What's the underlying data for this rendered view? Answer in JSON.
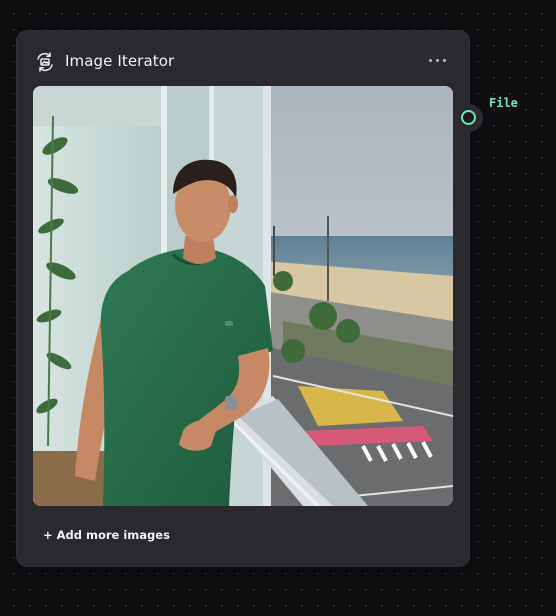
{
  "node": {
    "title": "Image Iterator",
    "icon": "image-loop-icon",
    "menu_icon": "more-horizontal-icon",
    "add_more_label": "+ Add more images",
    "image": {
      "description_icon": "photo-thumbnail"
    }
  },
  "output": {
    "label": "File",
    "color": "#6ee7b7"
  },
  "colors": {
    "canvas": "#0f0f12",
    "node_bg": "#29292e",
    "accent": "#6ee7b7"
  }
}
